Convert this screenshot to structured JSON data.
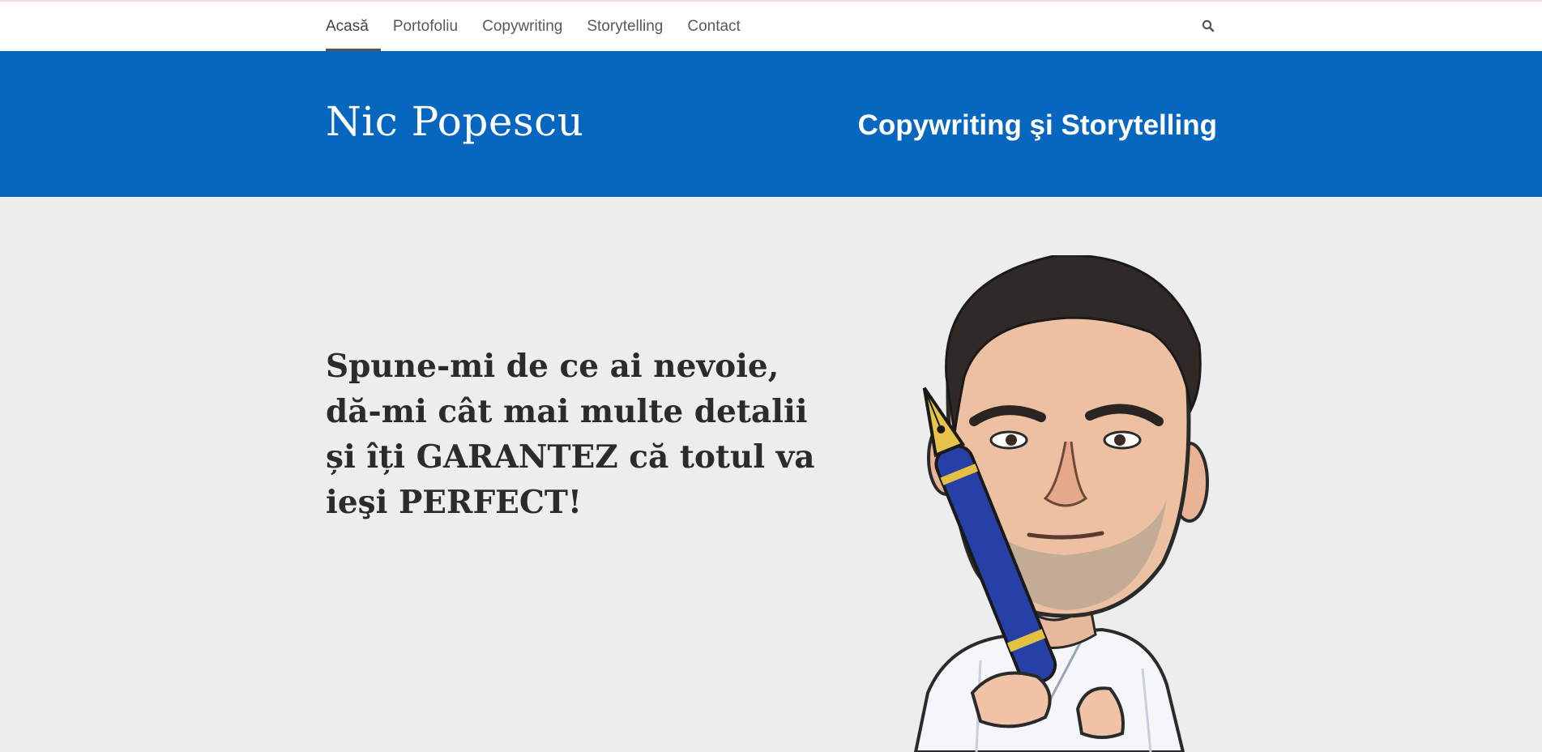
{
  "nav": {
    "items": [
      {
        "label": "Acasă",
        "active": true
      },
      {
        "label": "Portofoliu",
        "active": false
      },
      {
        "label": "Copywriting",
        "active": false
      },
      {
        "label": "Storytelling",
        "active": false
      },
      {
        "label": "Contact",
        "active": false
      }
    ],
    "search_icon": "search-icon"
  },
  "header": {
    "title": "Nic Popescu",
    "tagline": "Copywriting şi Storytelling",
    "background_color": "#0767bf"
  },
  "hero": {
    "lines": [
      "Spune-mi de ce ai nevoie,",
      "dă-mi cât mai multe detalii",
      "și îți GARANTEZ că totul va",
      "ieşi PERFECT!"
    ],
    "image": "caricature-with-fountain-pen"
  }
}
